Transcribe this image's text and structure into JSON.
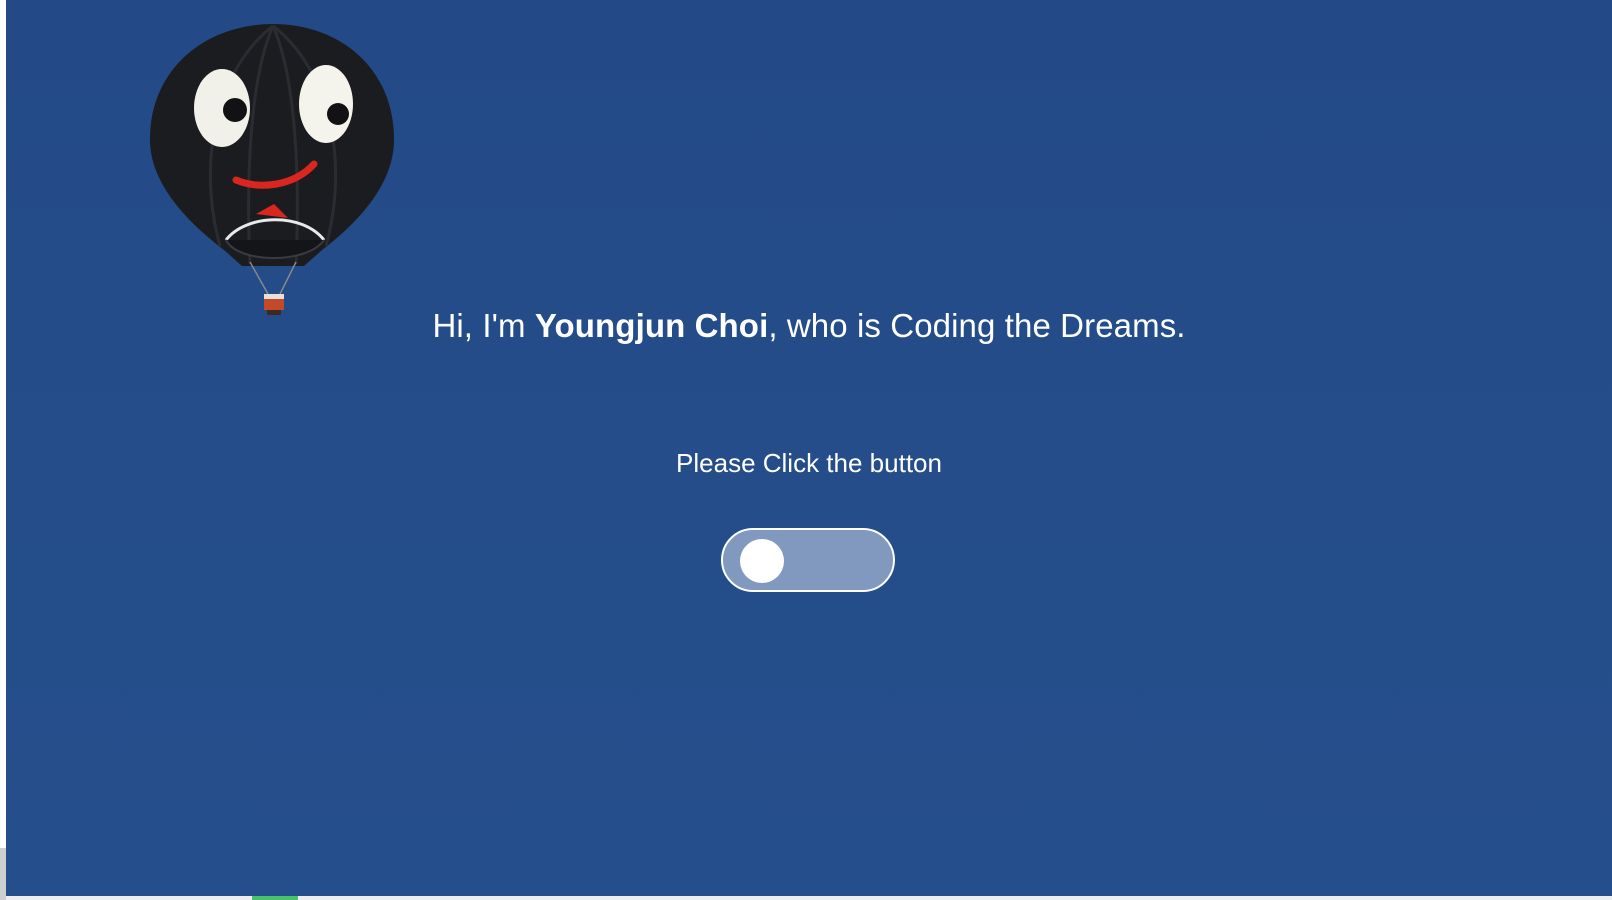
{
  "hero": {
    "greeting_prefix": "Hi, I'm ",
    "name": "Youngjun Choi",
    "greeting_suffix": ", who is Coding the Dreams.",
    "prompt": "Please Click the button"
  },
  "toggle": {
    "state": "off"
  },
  "colors": {
    "background": "#234a86",
    "text": "#ffffff",
    "toggle_track": "#a9b9d6",
    "toggle_knob": "#ffffff"
  },
  "icons": {
    "balloon": "hot-air-balloon-icon"
  }
}
